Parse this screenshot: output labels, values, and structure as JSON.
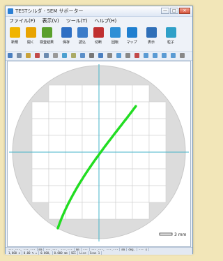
{
  "window": {
    "title": "TESTシルダ - SEM サポーター",
    "min_symbol": "—",
    "max_symbol": "□",
    "close_symbol": "✕"
  },
  "menu": [
    "ファイル(F)",
    "表示(V)",
    "ツール(T)",
    "ヘルプ(H)"
  ],
  "toolbar": {
    "buttons": [
      {
        "label": "新規",
        "icon": "new-file-icon",
        "color": "#f0b400"
      },
      {
        "label": "開く",
        "icon": "open-folder-icon",
        "color": "#e8a300"
      },
      {
        "label": "検査結果",
        "icon": "inspection-result-icon",
        "color": "#5aa02c"
      },
      {
        "label": "保存",
        "icon": "save-icon",
        "color": "#2e6fc4"
      },
      {
        "label": "読込",
        "icon": "load-icon",
        "color": "#3b7cc9"
      },
      {
        "label": "切断",
        "icon": "disconnect-icon",
        "color": "#c03030"
      },
      {
        "label": "回転",
        "icon": "rotate-icon",
        "color": "#2d8fd6"
      },
      {
        "label": "マップ",
        "icon": "map-icon",
        "color": "#1e7fd0"
      },
      {
        "label": "表示",
        "icon": "display-icon",
        "color": "#2f6fb8"
      },
      {
        "label": "粒子",
        "icon": "particle-icon",
        "color": "#2fa0c8"
      }
    ]
  },
  "statusbar": {
    "row1": [
      "---.---, ---.---",
      "mm",
      "---.---, ---.---",
      "mm",
      "---",
      "---.---, ---.---",
      "mm",
      "deg.",
      "--- x"
    ],
    "row2": [
      "1,000 x",
      "0.00 % =",
      "0.000,",
      "0.000 mm",
      "SEI",
      "Live",
      "Scan 1"
    ]
  },
  "wafer": {
    "scale_label": "3 mm",
    "colors": {
      "background": "#dcdcdc",
      "die": "#ffffff",
      "axis": "#45b3c8",
      "trace": "#22dd22"
    }
  }
}
